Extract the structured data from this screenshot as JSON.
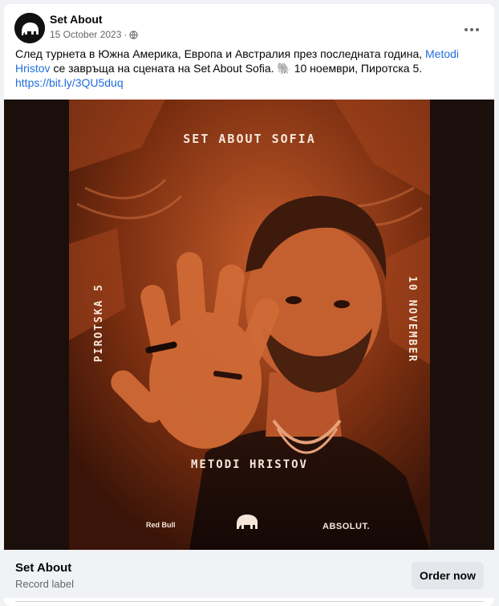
{
  "post": {
    "page_name": "Set About",
    "date": "15 October 2023",
    "separator": "·",
    "privacy_icon": "globe-icon",
    "more_icon": "more-options-icon",
    "caption": {
      "before_link": "След турнета в Южна Америка, Европа и Австралия през последната година, ",
      "link_text": "Metodi Hristov",
      "after_link": " се завръща на сцената на Set About Sofia. 🐘 10 ноември, Пиротска 5.",
      "url": "https://bit.ly/3QU5duq"
    }
  },
  "poster": {
    "top_text": "SET ABOUT SOFIA",
    "left_text": "PIROTSKA 5",
    "right_text": "10 NOVEMBER",
    "artist_name": "METODI HRISTOV",
    "sponsor_left": "Red Bull",
    "sponsor_right": "ABSOLUT.",
    "center_logo": "elephant-logo-icon",
    "tint_color": "#b3491d"
  },
  "footer": {
    "title": "Set About",
    "subtitle": "Record label",
    "button_label": "Order now"
  },
  "colors": {
    "link": "#216fdb",
    "background": "#f0f2f5",
    "button_bg": "#e4e6eb",
    "secondary_text": "#65676b"
  }
}
